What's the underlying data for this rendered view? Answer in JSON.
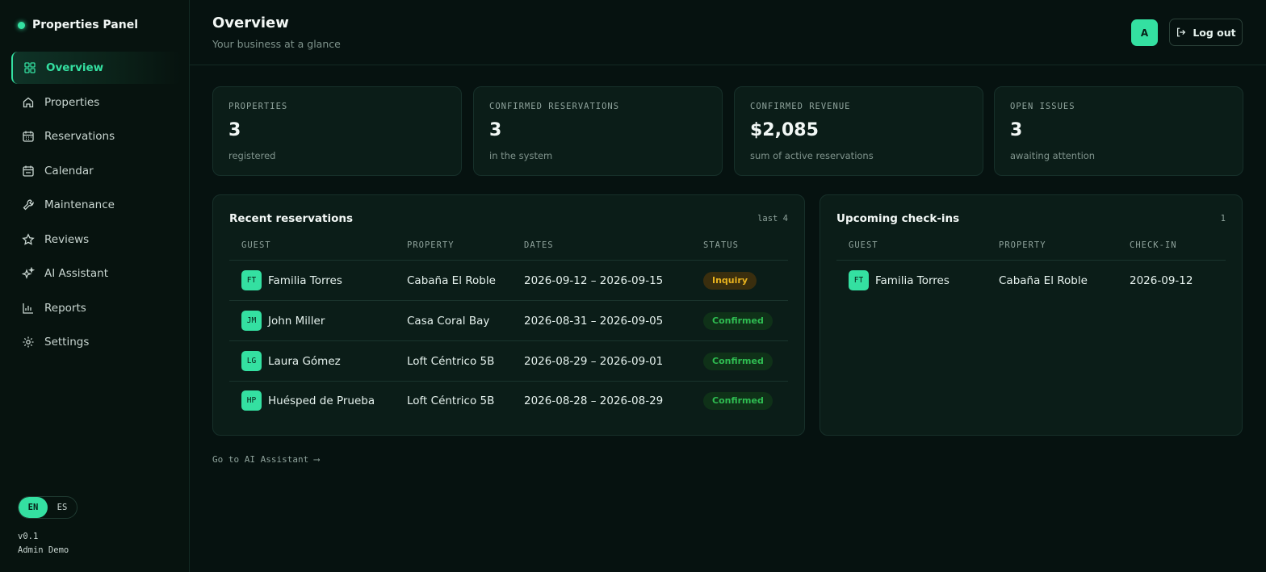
{
  "app": {
    "title": "Properties Panel"
  },
  "sidebar": {
    "items": [
      {
        "label": "Overview",
        "icon": "grid-icon",
        "active": true
      },
      {
        "label": "Properties",
        "icon": "home-icon"
      },
      {
        "label": "Reservations",
        "icon": "calendar-grid-icon"
      },
      {
        "label": "Calendar",
        "icon": "calendar-icon"
      },
      {
        "label": "Maintenance",
        "icon": "wrench-icon"
      },
      {
        "label": "Reviews",
        "icon": "star-icon"
      },
      {
        "label": "AI Assistant",
        "icon": "sparkles-icon"
      },
      {
        "label": "Reports",
        "icon": "bar-chart-icon"
      },
      {
        "label": "Settings",
        "icon": "gear-icon"
      }
    ],
    "lang": {
      "en": "EN",
      "es": "ES",
      "selected": "EN"
    },
    "version": "v0.1",
    "user": "Admin Demo"
  },
  "header": {
    "title": "Overview",
    "subtitle": "Your business at a glance",
    "avatar": "A",
    "logout": "Log out"
  },
  "stats": [
    {
      "label": "PROPERTIES",
      "value": "3",
      "sub": "registered"
    },
    {
      "label": "CONFIRMED RESERVATIONS",
      "value": "3",
      "sub": "in the system"
    },
    {
      "label": "CONFIRMED REVENUE",
      "value": "$2,085",
      "sub": "sum of active reservations"
    },
    {
      "label": "OPEN ISSUES",
      "value": "3",
      "sub": "awaiting attention"
    }
  ],
  "recent": {
    "title": "Recent reservations",
    "meta": "last 4",
    "columns": [
      "GUEST",
      "PROPERTY",
      "DATES",
      "STATUS"
    ],
    "rows": [
      {
        "initials": "FT",
        "guest": "Familia Torres",
        "property": "Cabaña El Roble",
        "dates": "2026-09-12 – 2026-09-15",
        "status": "Inquiry"
      },
      {
        "initials": "JM",
        "guest": "John Miller",
        "property": "Casa Coral Bay",
        "dates": "2026-08-31 – 2026-09-05",
        "status": "Confirmed"
      },
      {
        "initials": "LG",
        "guest": "Laura Gómez",
        "property": "Loft Céntrico 5B",
        "dates": "2026-08-29 – 2026-09-01",
        "status": "Confirmed"
      },
      {
        "initials": "HP",
        "guest": "Huésped de Prueba",
        "property": "Loft Céntrico 5B",
        "dates": "2026-08-28 – 2026-08-29",
        "status": "Confirmed"
      }
    ]
  },
  "upcoming": {
    "title": "Upcoming check-ins",
    "meta": "1",
    "columns": [
      "GUEST",
      "PROPERTY",
      "CHECK-IN"
    ],
    "rows": [
      {
        "initials": "FT",
        "guest": "Familia Torres",
        "property": "Cabaña El Roble",
        "checkin": "2026-09-12"
      }
    ]
  },
  "ai_link": "Go to AI Assistant ⟶",
  "colors": {
    "accent": "#34e0a1",
    "inquiry": "#e8b21e",
    "confirmed": "#2fbd52",
    "background": "#061210"
  }
}
